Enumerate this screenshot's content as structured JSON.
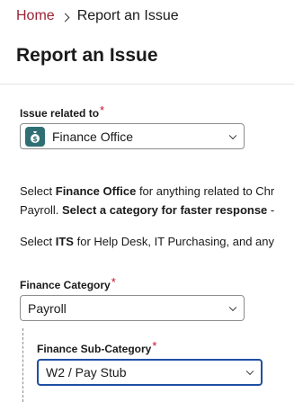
{
  "breadcrumb": {
    "home": "Home",
    "current": "Report an Issue"
  },
  "page": {
    "title": "Report an Issue"
  },
  "issue": {
    "label": "Issue related to",
    "required_mark": "*",
    "value": "Finance Office",
    "icon": "money-bag-icon",
    "icon_color": "#2f6f73"
  },
  "help": {
    "line1_pre": "Select ",
    "line1_bold": "Finance Office",
    "line1_post": " for anything related to Chr",
    "line2_pre": "Payroll. ",
    "line2_bold": "Select a category for faster response",
    "line2_post": " -",
    "line3_pre": "Select ",
    "line3_bold": "ITS",
    "line3_post": " for Help Desk, IT Purchasing, and any"
  },
  "category": {
    "label": "Finance Category",
    "required_mark": "*",
    "value": "Payroll"
  },
  "subcategory": {
    "label": "Finance Sub-Category",
    "required_mark": "*",
    "value": "W2 / Pay Stub"
  },
  "colors": {
    "link": "#9b2335",
    "required": "#c8102e",
    "focus": "#1f4fa3"
  }
}
